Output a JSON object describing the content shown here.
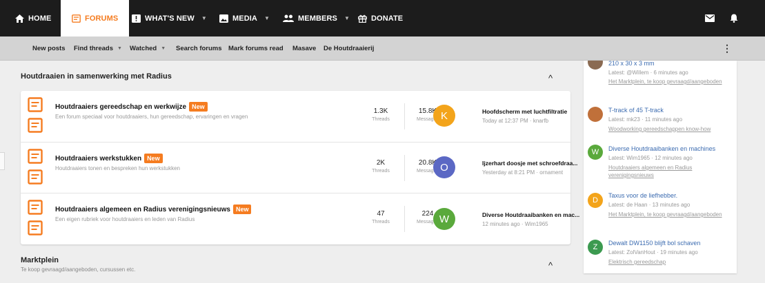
{
  "topnav": {
    "items": [
      {
        "label": "HOME",
        "icon": "home-icon"
      },
      {
        "label": "FORUMS",
        "icon": "forum-icon",
        "active": true
      },
      {
        "label": "WHAT'S NEW",
        "icon": "alert-box-icon",
        "dropdown": true
      },
      {
        "label": "MEDIA",
        "icon": "image-icon",
        "dropdown": true
      },
      {
        "label": "MEMBERS",
        "icon": "members-icon",
        "dropdown": true
      },
      {
        "label": "DONATE",
        "icon": "gift-icon"
      }
    ],
    "right_icons": [
      "mail-icon",
      "bell-icon"
    ]
  },
  "subnav": {
    "items": [
      {
        "label": "New posts"
      },
      {
        "label": "Find threads",
        "dropdown": true
      },
      {
        "label": "Watched",
        "dropdown": true
      },
      {
        "label": "Search forums"
      },
      {
        "label": "Mark forums read"
      },
      {
        "label": "Masave"
      },
      {
        "label": "De Houtdraaierij"
      }
    ],
    "more_icon": "⋮"
  },
  "categories": [
    {
      "title": "Houtdraaien in samenwerking met Radius",
      "subtitle": "",
      "collapse_glyph": "^",
      "forums": [
        {
          "title": "Houtdraaiers gereedschap en werkwijze",
          "badge": "New",
          "description": "Een forum speciaal voor houtdraaiers, hun gereedschap, ervaringen en vragen",
          "threads": "1.3K",
          "threads_label": "Threads",
          "messages": "15.8K",
          "messages_label": "Messages",
          "last_avatar_letter": "K",
          "last_avatar_color": "#f3a41b",
          "last_title": "Hoofdscherm met luchtfiltratie",
          "last_meta": "Today at 12:37 PM · knarfb"
        },
        {
          "title": "Houtdraaiers werkstukken",
          "badge": "New",
          "description": "Houtdraaiers tonen en bespreken hun werkstukken",
          "threads": "2K",
          "threads_label": "Threads",
          "messages": "20.8K",
          "messages_label": "Messages",
          "last_avatar_letter": "O",
          "last_avatar_color": "#5b68c4",
          "last_title": "Ijzerhart doosje met schroefdraa...",
          "last_meta": "Yesterday at 8:21 PM · ornament"
        },
        {
          "title": "Houtdraaiers algemeen en Radius verenigingsnieuws",
          "badge": "New",
          "description": "Een eigen rubriek voor houtdraaiers en leden van Radius",
          "threads": "47",
          "threads_label": "Threads",
          "messages": "224",
          "messages_label": "Messages",
          "last_avatar_letter": "W",
          "last_avatar_color": "#5aa93c",
          "last_title": "Diverse Houtdraaibanken en mac...",
          "last_meta": "12 minutes ago · Wim1965"
        }
      ]
    },
    {
      "title": "Marktplein",
      "subtitle": "Te koop gevraagd/aangeboden, cursussen etc.",
      "collapse_glyph": "^"
    }
  ],
  "sidebar": {
    "items": [
      {
        "title": "210 x 30 x 3 mm",
        "latest": "Latest: @Willem · 6 minutes ago",
        "forum": "Het Marktplein, te koop gevraagd/aangeboden",
        "avatar_kind": "photo",
        "avatar_color": "#8a6a52"
      },
      {
        "title": "T-track of 45 T-track",
        "latest": "Latest: mk23 · 11 minutes ago",
        "forum": "Woodworking gereedschappen know-how",
        "avatar_kind": "photo",
        "avatar_color": "#c0703a"
      },
      {
        "title": "Diverse Houtdraaibanken en machines",
        "latest": "Latest: Wim1965 · 12 minutes ago",
        "forum": "Houtdraaiers algemeen en Radius verenigingsnieuws",
        "avatar_kind": "letter",
        "avatar_letter": "W",
        "avatar_color": "#5aa93c"
      },
      {
        "title": "Taxus voor de liefhebber.",
        "latest": "Latest: de Haan · 13 minutes ago",
        "forum": "Het Marktplein, te koop gevraagd/aangeboden",
        "avatar_kind": "letter",
        "avatar_letter": "D",
        "avatar_color": "#f3a41b"
      },
      {
        "title": "Dewalt DW1150 blijft bol schaven",
        "latest": "Latest: ZolVanHout · 19 minutes ago",
        "forum": "Elektrisch gereedschap",
        "avatar_kind": "letter",
        "avatar_letter": "Z",
        "avatar_color": "#3c9a50"
      }
    ]
  },
  "colors": {
    "accent": "#f57c20",
    "topbar": "#1c1c1c",
    "subbar": "#d3d3d3",
    "link": "#3b6bb0"
  }
}
